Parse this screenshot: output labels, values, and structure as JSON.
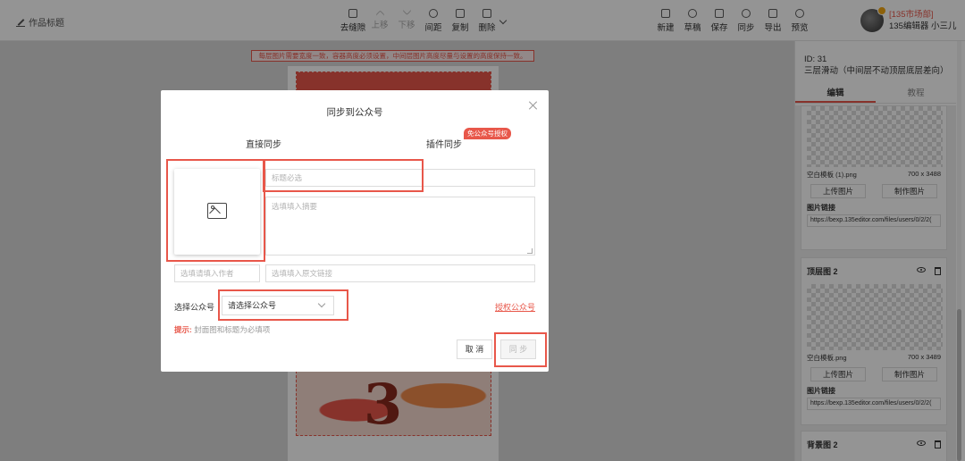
{
  "topbar": {
    "doc_title": "作品标题",
    "center_tools": [
      {
        "name": "去缝隙",
        "enabled": true
      },
      {
        "name": "上移",
        "enabled": false
      },
      {
        "name": "下移",
        "enabled": false
      },
      {
        "name": "间距",
        "enabled": true
      },
      {
        "name": "复制",
        "enabled": true
      },
      {
        "name": "删除",
        "enabled": true
      }
    ],
    "right_tools": [
      "新建",
      "草稿",
      "保存",
      "同步",
      "导出",
      "预览"
    ],
    "user": {
      "plan": "[135市场部]",
      "name": "135编辑器 小三儿"
    }
  },
  "warning": "每层图片需要宽度一致，容器高度必须设置，中间层图片高度尽量与设置的高度保持一致。",
  "right_panel": {
    "id": "ID: 31",
    "desc": "三层滑动（中间层不动顶层底层差向）",
    "tabs": [
      "编辑",
      "教程"
    ],
    "active_tab": "编辑",
    "cards": [
      {
        "title": "",
        "file": "空白模板 (1).png",
        "size": "700 x 3488",
        "upload": "上传图片",
        "make": "制作图片",
        "link_label": "图片链接",
        "link": "https://bexp.135editor.com/files/users/0/2/2("
      },
      {
        "title": "顶层图 2",
        "file": "空白模板.png",
        "size": "700 x 3489",
        "upload": "上传图片",
        "make": "制作图片",
        "link_label": "图片链接",
        "link": "https://bexp.135editor.com/files/users/0/2/2("
      },
      {
        "title": "背景图 2"
      }
    ]
  },
  "modal": {
    "title": "同步到公众号",
    "tab_direct": "直接同步",
    "tab_plugin": "插件同步",
    "tab_plugin_tag": "免公众号授权",
    "title_placeholder": "标题必选",
    "summary_placeholder": "选填填入摘要",
    "author_placeholder": "选填请填入作者",
    "link_placeholder": "选填填入原文链接",
    "select_label": "选择公众号",
    "select_value": "请选择公众号",
    "auth_link": "授权公众号",
    "tip_key": "提示:",
    "tip_text": "封面图和标题为必填项",
    "cancel": "取 消",
    "sync": "同 步"
  },
  "colors": {
    "accent": "#e8574a",
    "overlay": "rgba(0,0,0,0.42)"
  }
}
